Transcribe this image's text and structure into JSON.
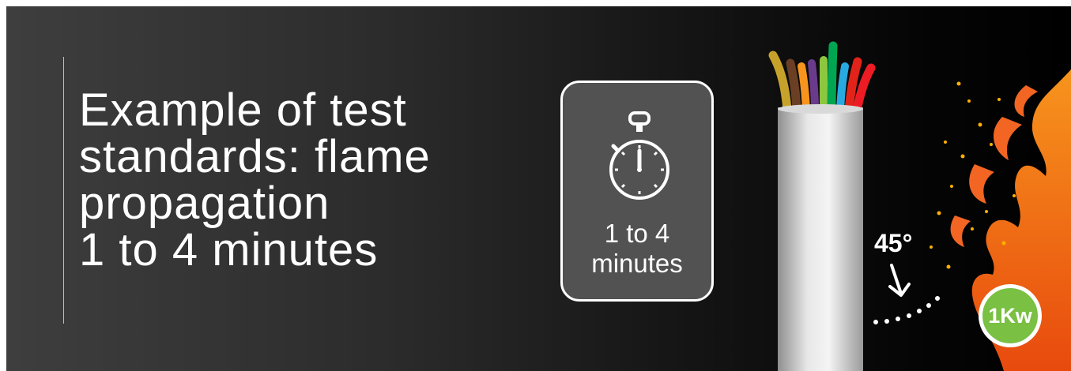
{
  "headline": {
    "lines": [
      "Example of test",
      "standards: flame",
      "propagation",
      "1 to 4 minutes"
    ]
  },
  "timer_card": {
    "icon": "stopwatch-icon",
    "line1": "1 to 4",
    "line2": "minutes"
  },
  "diagram": {
    "angle_label": "45°",
    "power_label": "1Kw",
    "icons": [
      "cable-illustration",
      "flame-illustration",
      "arrow-icon"
    ]
  },
  "colors": {
    "background_light": "#3e3e3e",
    "background_dark": "#000000",
    "card": "#525252",
    "badge": "#79c043",
    "flame_orange": "#f26522",
    "spark": "#ffb000",
    "wires": [
      "#c7a22b",
      "#6b3f24",
      "#f7941d",
      "#6a3b8c",
      "#8dc63f",
      "#00a651",
      "#27aae1",
      "#e2231a",
      "#ed1c24"
    ]
  }
}
